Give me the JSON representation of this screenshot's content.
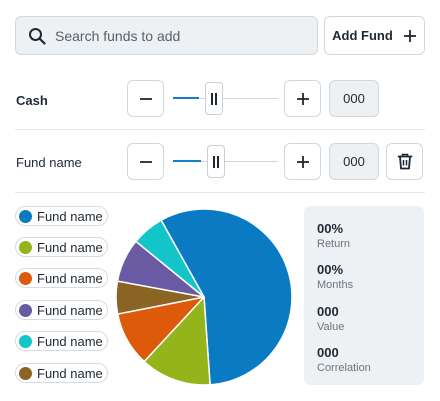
{
  "search": {
    "placeholder": "Search funds to add",
    "icon": "search-icon"
  },
  "add_fund": {
    "label": "Add Fund",
    "icon": "plus-icon"
  },
  "rows": [
    {
      "label": "Cash",
      "value": "000",
      "allocation": 0.25
    },
    {
      "label": "Fund name",
      "value": "000",
      "allocation": 0.27
    }
  ],
  "colors": {
    "accent": "#1480c6",
    "blue": "#0a7bc2",
    "green": "#93b51b",
    "orange": "#dc5a0a",
    "brown": "#8a6423",
    "purple": "#6a5aa3",
    "teal": "#13c5c8"
  },
  "legend": [
    {
      "label": "Fund name",
      "color": "#0a7bc2"
    },
    {
      "label": "Fund name",
      "color": "#93b51b"
    },
    {
      "label": "Fund name",
      "color": "#dc5a0a"
    },
    {
      "label": "Fund name",
      "color": "#6a5aa3"
    },
    {
      "label": "Fund name",
      "color": "#13c5c8"
    },
    {
      "label": "Fund name",
      "color": "#8a6423"
    }
  ],
  "chart_data": {
    "type": "pie",
    "slices": [
      {
        "color": "#0a7bc2",
        "value": 57
      },
      {
        "color": "#93b51b",
        "value": 13
      },
      {
        "color": "#dc5a0a",
        "value": 10
      },
      {
        "color": "#8a6423",
        "value": 6
      },
      {
        "color": "#6a5aa3",
        "value": 8
      },
      {
        "color": "#13c5c8",
        "value": 6
      }
    ]
  },
  "stats": [
    {
      "value": "00%",
      "label": "Return"
    },
    {
      "value": "00%",
      "label": "Months"
    },
    {
      "value": "000",
      "label": "Value"
    },
    {
      "value": "000",
      "label": "Correlation"
    }
  ]
}
